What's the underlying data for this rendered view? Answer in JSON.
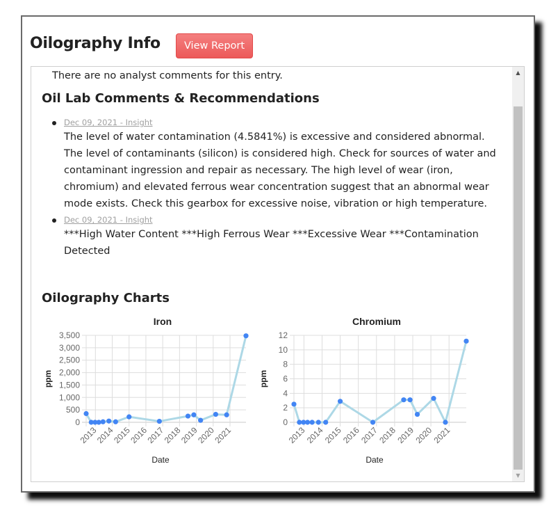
{
  "header": {
    "title": "Oilography Info",
    "view_report_label": "View Report"
  },
  "panel": {
    "analyst_comments_text": "There are no analyst comments for this entry.",
    "lab_section_title": "Oil Lab Comments & Recommendations",
    "comments": [
      {
        "link": "Dec 09, 2021 - Insight",
        "text": "The level of water contamination (4.5841%) is excessive and considered abnormal. The level of contaminants (silicon) is considered high. Check for sources of water and contaminant ingression and repair as necessary. The high level of wear (iron, chromium) and elevated ferrous wear concentration suggest that an abnormal wear mode exists. Check this gearbox for excessive noise, vibration or high temperature."
      },
      {
        "link": "Dec 09, 2021 - Insight",
        "text": "***High Water Content ***High Ferrous Wear ***Excessive Wear ***Contamination Detected"
      }
    ],
    "charts_section_title": "Oilography Charts"
  },
  "scrollbar": {
    "up_icon": "▲",
    "down_icon": "▼"
  },
  "colors": {
    "line": "#add8e6",
    "point": "#4285f4",
    "grid": "#dddddd",
    "button": "#ef6b6b"
  },
  "chart_data": [
    {
      "type": "line",
      "title": "Iron",
      "xlabel": "Date",
      "ylabel": "ppm",
      "x_ticks": [
        "2013",
        "2014",
        "2015",
        "2016",
        "2017",
        "2018",
        "2019",
        "2020",
        "2021"
      ],
      "xlim": [
        2012.45,
        2021.95
      ],
      "ylim": [
        0,
        3500
      ],
      "y_ticks": [
        0,
        500,
        1000,
        1500,
        2000,
        2500,
        3000,
        3500
      ],
      "y_tick_labels": [
        "0",
        "500",
        "1,000",
        "1,500",
        "2,000",
        "2,500",
        "3,000",
        "3,500"
      ],
      "grid": true,
      "x": [
        2012.45,
        2012.75,
        2012.98,
        2013.2,
        2013.45,
        2013.8,
        2014.2,
        2015.0,
        2016.8,
        2018.5,
        2018.85,
        2019.25,
        2020.15,
        2020.8,
        2021.95
      ],
      "y": [
        350,
        0,
        0,
        0,
        20,
        50,
        20,
        220,
        40,
        250,
        300,
        80,
        320,
        300,
        3480
      ]
    },
    {
      "type": "line",
      "title": "Chromium",
      "xlabel": "Date",
      "ylabel": "ppm",
      "x_ticks": [
        "2013",
        "2014",
        "2015",
        "2016",
        "2017",
        "2018",
        "2019",
        "2020",
        "2021"
      ],
      "xlim": [
        2012.45,
        2021.95
      ],
      "ylim": [
        0,
        12
      ],
      "y_ticks": [
        0,
        2,
        4,
        6,
        8,
        10,
        12
      ],
      "y_tick_labels": [
        "0",
        "2",
        "4",
        "6",
        "8",
        "10",
        "12"
      ],
      "grid": true,
      "x": [
        2012.45,
        2012.75,
        2012.98,
        2013.2,
        2013.45,
        2013.8,
        2014.2,
        2015.0,
        2016.8,
        2018.5,
        2018.85,
        2019.25,
        2020.15,
        2020.8,
        2021.95
      ],
      "y": [
        2.5,
        0,
        0,
        0,
        0,
        0,
        0,
        2.9,
        0,
        3.1,
        3.1,
        1.1,
        3.3,
        0,
        11.2
      ]
    }
  ]
}
